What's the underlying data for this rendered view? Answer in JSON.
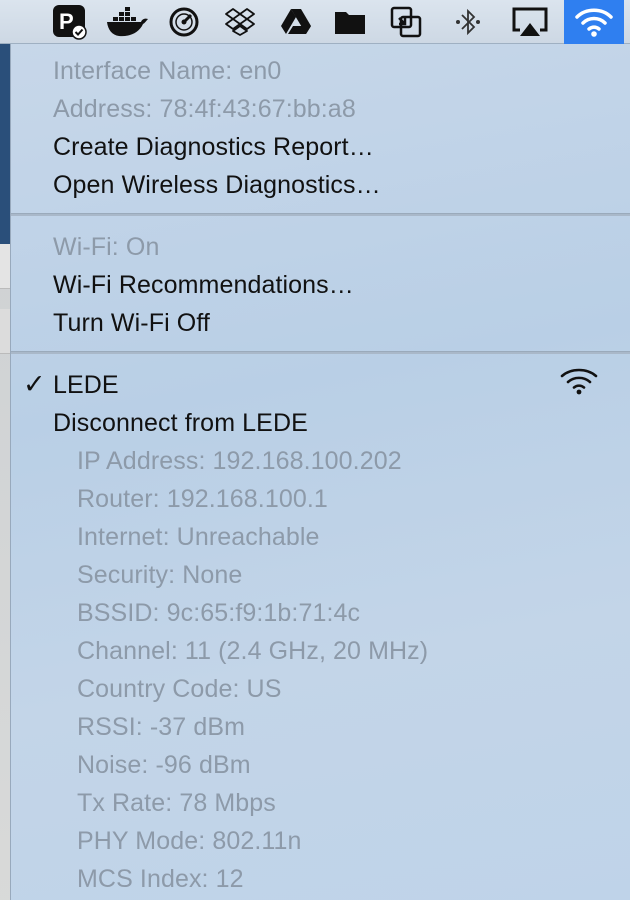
{
  "menubar": {
    "icons": [
      {
        "name": "pcloud-check-icon"
      },
      {
        "name": "docker-icon"
      },
      {
        "name": "speedometer-icon"
      },
      {
        "name": "dropbox-icon"
      },
      {
        "name": "google-drive-icon"
      },
      {
        "name": "folder-icon"
      },
      {
        "name": "window-switch-icon"
      },
      {
        "name": "bluetooth-icon"
      },
      {
        "name": "airplay-icon"
      },
      {
        "name": "wifi-icon",
        "active": true
      }
    ]
  },
  "menu": {
    "interface": {
      "name_line": "Interface Name: en0",
      "address_line": "Address: 78:4f:43:67:bb:a8",
      "create_report": "Create Diagnostics Report…",
      "open_diagnostics": "Open Wireless Diagnostics…"
    },
    "wifi": {
      "status": "Wi-Fi: On",
      "recommendations": "Wi-Fi Recommendations…",
      "turn_off": "Turn Wi-Fi Off"
    },
    "network": {
      "checkmark": "✓",
      "name": "LEDE",
      "disconnect": "Disconnect from LEDE",
      "details": [
        "IP Address: 192.168.100.202",
        "Router: 192.168.100.1",
        "Internet: Unreachable",
        "Security: None",
        "BSSID: 9c:65:f9:1b:71:4c",
        "Channel: 11 (2.4 GHz, 20 MHz)",
        "Country Code: US",
        "RSSI: -37 dBm",
        "Noise: -96 dBm",
        "Tx Rate: 78 Mbps",
        "PHY Mode: 802.11n",
        "MCS Index: 12"
      ]
    }
  },
  "colors": {
    "active_icon_bg": "#2f7ff0",
    "disabled_text": "#8d9aa9",
    "enabled_text": "#111111"
  }
}
